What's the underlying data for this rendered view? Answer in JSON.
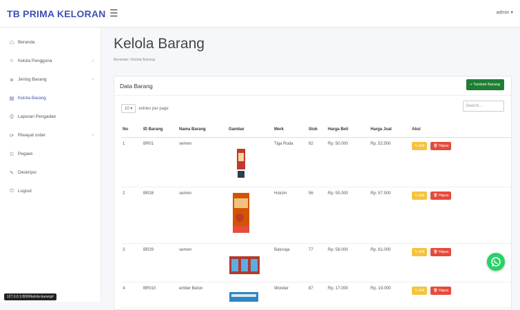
{
  "app": {
    "brand": "TB PRIMA KELORAN",
    "user_label": "admin ▾"
  },
  "sidebar": {
    "items": [
      {
        "label": "Beranda",
        "icon": "☖",
        "chevron": ""
      },
      {
        "label": "Kelola Pengguna",
        "icon": "☺",
        "chevron": "‹"
      },
      {
        "label": "Jenlsg Barang",
        "icon": "≣",
        "chevron": "‹"
      },
      {
        "label": "Kelola Barang",
        "icon": "▤",
        "chevron": ""
      },
      {
        "label": "Laporan Pengadan",
        "icon": "⎙",
        "chevron": ""
      },
      {
        "label": "Riwayat order",
        "icon": "⟳",
        "chevron": "‹"
      },
      {
        "label": "Pegawi",
        "icon": "☷",
        "chevron": ""
      },
      {
        "label": "Deskripsi",
        "icon": "✎",
        "chevron": ""
      },
      {
        "label": "Logout",
        "icon": "⏻",
        "chevron": ""
      }
    ],
    "url_tip": "127.0.0.1:8000/kelola-barang#"
  },
  "main": {
    "title": "Kelola Barang",
    "breadcrumb": "Beranda / Kelola Barang",
    "card_title": "Data Barang",
    "add_label": "+ Tambah Barang",
    "entries_value": "10 ▾",
    "entries_suffix": "entries per page",
    "search_placeholder": "Search...",
    "columns": [
      "No",
      "ID Barang",
      "Nama Barang",
      "Gambar",
      "Merk",
      "Stok",
      "Harga Beli",
      "Harga Jual",
      "Aksi"
    ],
    "rows": [
      {
        "no": "1",
        "id": "BR01",
        "nama": "semen",
        "merk": "Tiga Roda",
        "stok": "92",
        "beli": "Rp. 50.000",
        "jual": "Rp. 52.500",
        "edit": "✎ Edit",
        "hapus": "🗑 Hapus"
      },
      {
        "no": "2",
        "id": "BR28",
        "nama": "semen",
        "merk": "Holcim",
        "stok": "56",
        "beli": "Rp. 55.000",
        "jual": "Rp. 57.500",
        "edit": "✎ Edit",
        "hapus": "🗑 Hapus"
      },
      {
        "no": "3",
        "id": "BR29",
        "nama": "semen",
        "merk": "Baturaja",
        "stok": "77",
        "beli": "Rp. 58.000",
        "jual": "Rp. 61.000",
        "edit": "✎ Edit",
        "hapus": "🗑 Hapus"
      },
      {
        "no": "4",
        "id": "BR010",
        "nama": "ember Beton",
        "merk": "Wonder",
        "stok": "87",
        "beli": "Rp. 17.000",
        "jual": "Rp. 19.000",
        "edit": "✎ Edit",
        "hapus": "🗑 Hapus"
      }
    ]
  },
  "colors": {
    "brand": "#3f51b5",
    "add_button": "#1e7e34",
    "edit": "#f6c23e",
    "hapus": "#e74a3b",
    "whatsapp": "#25d366"
  },
  "icons": {
    "menu": "hamburger-icon",
    "whatsapp": "whatsapp-icon"
  }
}
